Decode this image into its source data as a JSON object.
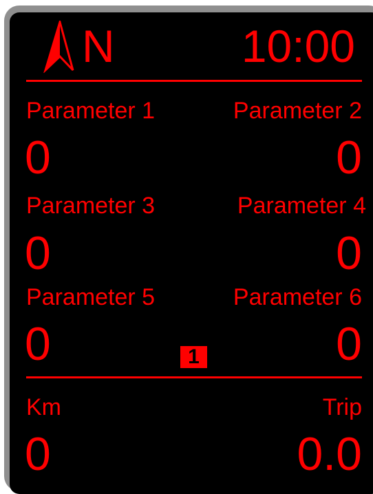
{
  "theme": {
    "accent": "#ff0000",
    "background": "#000000",
    "bezel": "#8f8f8f"
  },
  "header": {
    "compass_icon": "compass-arrow-icon",
    "heading": "N",
    "clock": "10:00"
  },
  "params": [
    {
      "label": "Parameter 1",
      "value": "0"
    },
    {
      "label": "Parameter 2",
      "value": "0"
    },
    {
      "label": "Parameter 3",
      "value": "0"
    },
    {
      "label": "Parameter 4",
      "value": "0"
    },
    {
      "label": "Parameter 5",
      "value": "0"
    },
    {
      "label": "Parameter 6",
      "value": "0"
    }
  ],
  "gear": "1",
  "footer": {
    "km_label": "Km",
    "km_value": "0",
    "trip_label": "Trip",
    "trip_value": "0.0"
  }
}
